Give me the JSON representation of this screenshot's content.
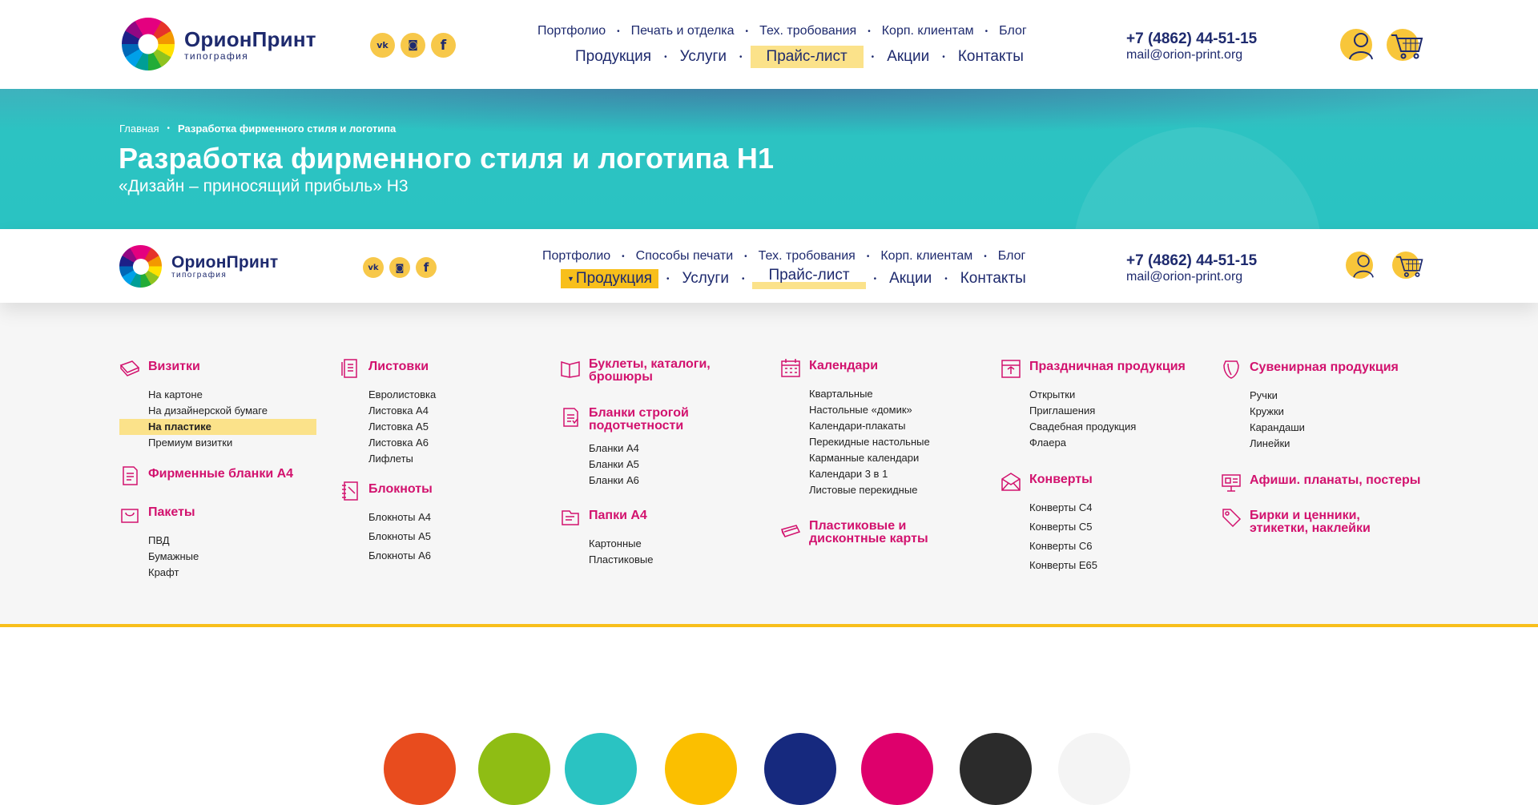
{
  "header": {
    "logo": {
      "name": "ОрионПринт",
      "sub": "типография"
    },
    "social": [
      {
        "icon": "vk-icon",
        "glyph": "vk"
      },
      {
        "icon": "instagram-icon",
        "glyph": "◙"
      },
      {
        "icon": "facebook-icon",
        "glyph": "f"
      }
    ],
    "nav_top": [
      "Портфолио",
      "Печать и отделка",
      "Тех. тробования",
      "Корп. клиентам",
      "Блог"
    ],
    "nav_top_sticky": [
      "Портфолио",
      "Способы печати",
      "Тех. тробования",
      "Корп. клиентам",
      "Блог"
    ],
    "nav_main": [
      "Продукция",
      "Услуги",
      "Прайс-лист",
      "Акции",
      "Контакты"
    ],
    "phone": "+7 (4862) 44-51-15",
    "email": "mail@orion-print.org",
    "user_icon": "user-icon",
    "cart_icon": "cart-icon"
  },
  "banner": {
    "breadcrumb": [
      "Главная",
      "Разработка фирменного стиля и логотипа"
    ],
    "title": "Разработка фирменного стиля и логотипа H1",
    "subtitle": "«Дизайн – приносящий прибыль» H3"
  },
  "menu": {
    "col1": [
      {
        "title": "Визитки",
        "icon": "business-cards-icon",
        "items": [
          "На картоне",
          "На дизайнерской бумаге",
          "На пластике",
          "Премиум визитки"
        ],
        "selected": "На пластике"
      },
      {
        "title": "Фирменные бланки А4",
        "icon": "letterhead-icon",
        "items": []
      },
      {
        "title": "Пакеты",
        "icon": "bag-icon",
        "items": [
          "ПВД",
          "Бумажные",
          "Крафт"
        ]
      }
    ],
    "col2": [
      {
        "title": "Листовки",
        "icon": "flyer-icon",
        "items": [
          "Евролистовка",
          "Листовка А4",
          "Листовка А5",
          "Листовка А6",
          "Лифлеты"
        ]
      },
      {
        "title": "Блокноты",
        "icon": "notebook-icon",
        "items": [
          "Блокноты А4",
          "Блокноты А5",
          "Блокноты А6"
        ]
      }
    ],
    "col3": [
      {
        "title": "Буклеты, каталоги, брошюры",
        "icon": "booklet-icon",
        "items": []
      },
      {
        "title": "Бланки строгой подотчетности",
        "icon": "forms-icon",
        "items": [
          "Бланки А4",
          "Бланки А5",
          "Бланки А6"
        ]
      },
      {
        "title": "Папки А4",
        "icon": "folder-icon",
        "items": [
          "Картонные",
          "Пластиковые"
        ]
      }
    ],
    "col4": [
      {
        "title": "Календари",
        "icon": "calendar-icon",
        "items": [
          "Квартальные",
          "Настольные «домик»",
          "Календари-плакаты",
          "Перекидные настольные",
          "Карманные календари",
          "Календари 3 в 1",
          "Листовые перекидные"
        ]
      },
      {
        "title": "Пластиковые и дисконтные карты",
        "icon": "cards-icon",
        "items": []
      }
    ],
    "col5": [
      {
        "title": "Праздничная продукция",
        "icon": "holiday-icon",
        "items": [
          "Открытки",
          "Приглашения",
          "Свадебная продукция",
          "Флаера"
        ]
      },
      {
        "title": "Конверты",
        "icon": "envelope-icon",
        "items": [
          "Конверты С4",
          "Конверты С5",
          "Конверты С6",
          "Конверты Е65"
        ]
      }
    ],
    "col6": [
      {
        "title": "Сувенирная продукция",
        "icon": "souvenir-icon",
        "items": [
          "Ручки",
          "Кружки",
          "Карандаши",
          "Линейки"
        ]
      },
      {
        "title": "Афиши. планаты, постеры",
        "icon": "poster-icon",
        "items": []
      },
      {
        "title": "Бирки и ценники, этикетки, наклейки",
        "icon": "tag-icon",
        "items": []
      }
    ]
  },
  "colors": {
    "navy": "#1e2a6e",
    "magenta": "#d2126e",
    "teal": "#2ac3c2",
    "yellow": "#f8bf1b",
    "swatches": [
      "#e84c1e",
      "#8fbd14",
      "#2ac3c2",
      "#fbbf00",
      "#16297e",
      "#de006c",
      "#2b2b2b",
      "#f4f4f4"
    ]
  }
}
